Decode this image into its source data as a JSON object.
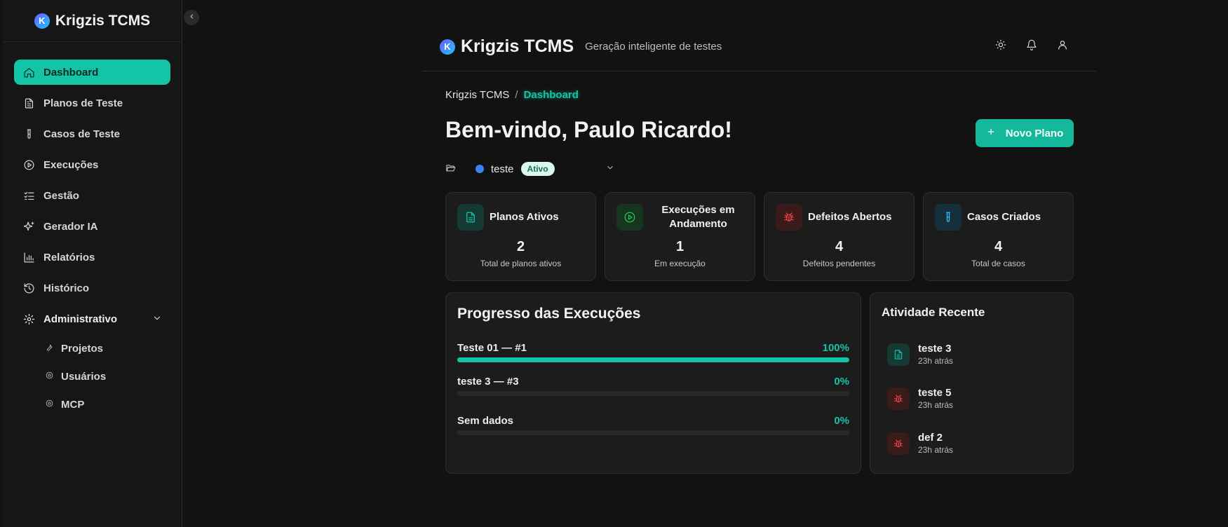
{
  "app": {
    "name": "Krigzis TCMS",
    "logo_letter": "K",
    "tagline": "Geração inteligente de testes"
  },
  "sidebar": {
    "items": [
      {
        "label": "Dashboard",
        "icon": "home-icon"
      },
      {
        "label": "Planos de Teste",
        "icon": "file-text-icon"
      },
      {
        "label": "Casos de Teste",
        "icon": "test-tube-icon"
      },
      {
        "label": "Execuções",
        "icon": "play-circle-icon"
      },
      {
        "label": "Gestão",
        "icon": "list-checks-icon"
      },
      {
        "label": "Gerador IA",
        "icon": "sparkles-icon"
      },
      {
        "label": "Relatórios",
        "icon": "bar-chart-icon"
      },
      {
        "label": "Histórico",
        "icon": "history-icon"
      }
    ],
    "admin": {
      "label": "Administrativo",
      "subitems": [
        {
          "label": "Projetos",
          "icon": "wrench-icon"
        },
        {
          "label": "Usuários",
          "icon": "gear-icon"
        },
        {
          "label": "MCP",
          "icon": "gear-icon"
        }
      ]
    }
  },
  "breadcrumb": {
    "root": "Krigzis TCMS",
    "separator": "/",
    "current": "Dashboard"
  },
  "welcome": "Bem-vindo, Paulo Ricardo!",
  "new_plan_button": "Novo Plano",
  "project": {
    "name": "teste",
    "status": "Ativo",
    "color": "#3b82f6"
  },
  "stats": [
    {
      "title": "Planos Ativos",
      "value": "2",
      "desc": "Total de planos ativos",
      "icon": "file-text-icon",
      "color": "#14c4a6"
    },
    {
      "title": "Execuções em Andamento",
      "value": "1",
      "desc": "Em execução",
      "icon": "play-circle-icon",
      "color": "#22c55e"
    },
    {
      "title": "Defeitos Abertos",
      "value": "4",
      "desc": "Defeitos pendentes",
      "icon": "bug-icon",
      "color": "#ef4444"
    },
    {
      "title": "Casos Criados",
      "value": "4",
      "desc": "Total de casos",
      "icon": "test-tube-icon",
      "color": "#38bdf8"
    }
  ],
  "progress": {
    "title": "Progresso das Execuções",
    "rows": [
      {
        "label": "Teste 01 — #1",
        "percent_text": "100%",
        "value": 100
      },
      {
        "label": "teste 3 — #3",
        "percent_text": "0%",
        "value": 0
      },
      {
        "label": "Sem dados",
        "percent_text": "0%",
        "value": 0
      }
    ]
  },
  "activity": {
    "title": "Atividade Recente",
    "items": [
      {
        "name": "teste 3",
        "time": "23h atrás",
        "icon": "file-text-icon",
        "color": "#14c4a6"
      },
      {
        "name": "teste 5",
        "time": "23h atrás",
        "icon": "bug-icon",
        "color": "#ef4444"
      },
      {
        "name": "def 2",
        "time": "23h atrás",
        "icon": "bug-icon",
        "color": "#ef4444"
      }
    ]
  },
  "colors": {
    "accent": "#14c4a6",
    "background": "#121212",
    "card": "#1c1c1c"
  }
}
